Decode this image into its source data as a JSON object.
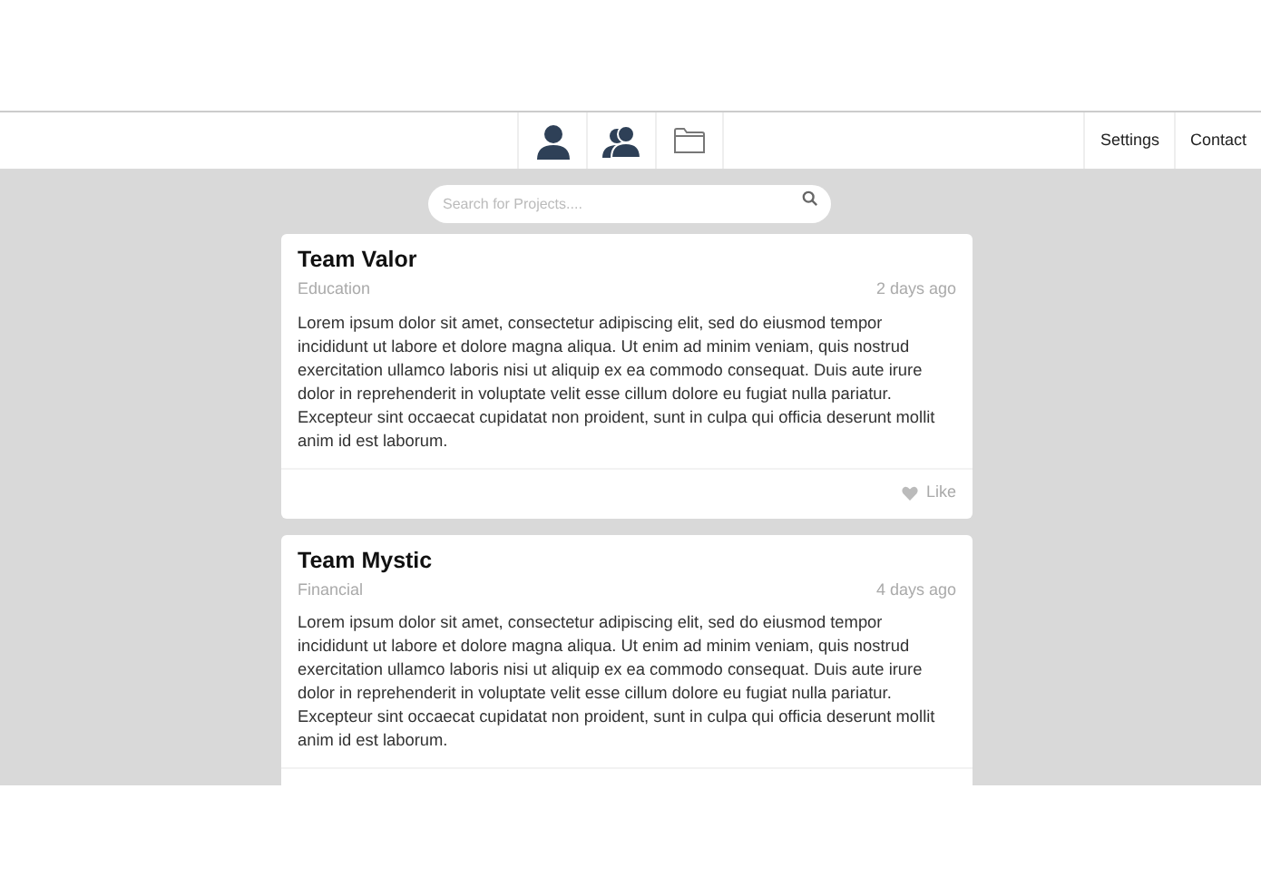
{
  "nav": {
    "icons": [
      {
        "kind": "person"
      },
      {
        "kind": "people"
      },
      {
        "kind": "folder"
      }
    ],
    "links": [
      "Settings",
      "Contact"
    ]
  },
  "search": {
    "placeholder": "Search for Projects...."
  },
  "cards": [
    {
      "title": "Team Valor",
      "category": "Education",
      "time": "2 days ago",
      "body": "Lorem ipsum dolor sit amet, consectetur adipiscing elit, sed do eiusmod tempor incididunt ut labore et dolore magna aliqua. Ut enim ad minim veniam, quis nostrud exercitation ullamco laboris nisi ut aliquip ex ea commodo consequat. Duis aute irure dolor in reprehenderit in voluptate velit esse cillum dolore eu fugiat nulla pariatur. Excepteur sint occaecat cupidatat non proident, sunt in culpa qui officia deserunt mollit anim id est laborum.",
      "like": "Like"
    },
    {
      "title": "Team Mystic",
      "category": "Financial",
      "time": "4 days ago",
      "body": "Lorem ipsum dolor sit amet, consectetur adipiscing elit, sed do eiusmod tempor incididunt ut labore et dolore magna aliqua. Ut enim ad minim veniam, quis nostrud exercitation ullamco laboris nisi ut aliquip ex ea commodo consequat. Duis aute irure dolor in reprehenderit in voluptate velit esse cillum dolore eu fugiat nulla pariatur. Excepteur sint occaecat cupidatat non proident, sunt in culpa qui officia deserunt mollit anim id est laborum."
    }
  ]
}
